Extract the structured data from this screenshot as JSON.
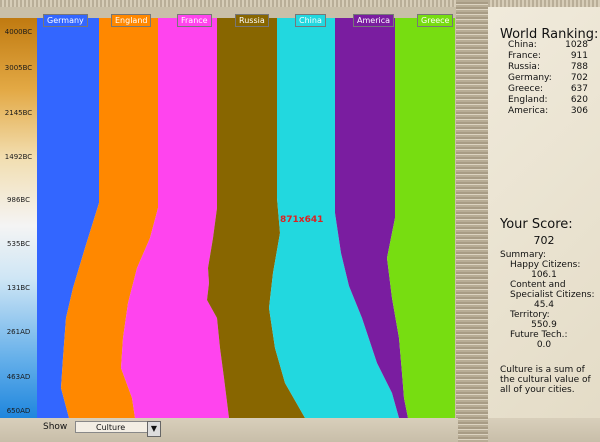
{
  "timeline": {
    "ticks": [
      "4000BC",
      "3005BC",
      "2145BC",
      "1492BC",
      "986BC",
      "535BC",
      "131BC",
      "261AD",
      "463AD",
      "650AD"
    ]
  },
  "chart_data": {
    "type": "area",
    "title": "",
    "series": [
      {
        "name": "Germany",
        "color": "#3366ff"
      },
      {
        "name": "England",
        "color": "#ff8800"
      },
      {
        "name": "France",
        "color": "#ff44ee"
      },
      {
        "name": "Russia",
        "color": "#886600"
      },
      {
        "name": "China",
        "color": "#22d8df"
      },
      {
        "name": "America",
        "color": "#7a1da0"
      },
      {
        "name": "Greece",
        "color": "#77dd11"
      }
    ]
  },
  "overlay_label": "871x641",
  "show": {
    "label": "Show",
    "selected": "Culture"
  },
  "ranking": {
    "title": "World Ranking:",
    "rows": [
      {
        "name": "China:",
        "value": "1028"
      },
      {
        "name": "France:",
        "value": "911"
      },
      {
        "name": "Russia:",
        "value": "788"
      },
      {
        "name": "Germany:",
        "value": "702"
      },
      {
        "name": "Greece:",
        "value": "637"
      },
      {
        "name": "England:",
        "value": "620"
      },
      {
        "name": "America:",
        "value": "306"
      }
    ]
  },
  "score": {
    "title": "Your Score:",
    "value": "702",
    "summary_label": "Summary:",
    "happy_label": "Happy Citizens:",
    "happy_value": "106.1",
    "content_label": "Content and Specialist Citizens:",
    "content_value": "45.4",
    "territory_label": "Territory:",
    "territory_value": "550.9",
    "future_label": "Future Tech.:",
    "future_value": "0.0"
  },
  "note": "Culture is a sum of the cultural value of all of your cities."
}
